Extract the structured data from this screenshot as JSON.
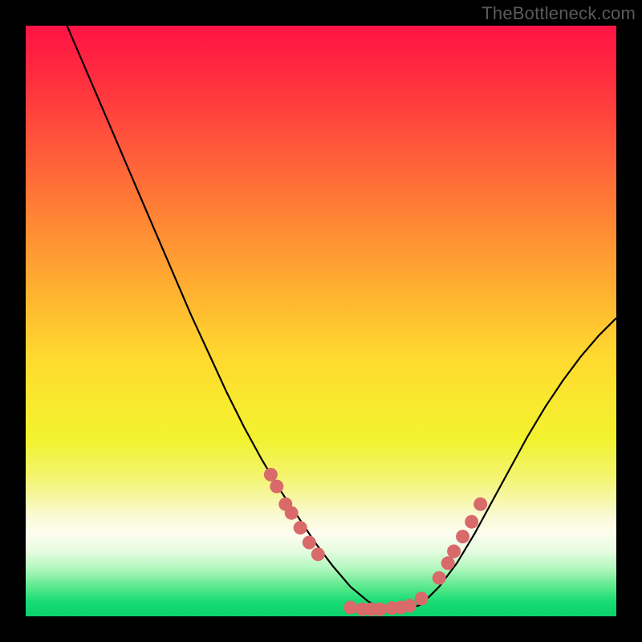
{
  "watermark": "TheBottleneck.com",
  "chart_data": {
    "type": "line",
    "title": "",
    "xlabel": "",
    "ylabel": "",
    "xlim": [
      0,
      100
    ],
    "ylim": [
      0,
      100
    ],
    "grid": false,
    "series": [
      {
        "name": "curve",
        "x": [
          7,
          10,
          13,
          16,
          19,
          22,
          25,
          28,
          31,
          34,
          37,
          40,
          43,
          46,
          49,
          52,
          55,
          58,
          61,
          64,
          67,
          70,
          73,
          76,
          79,
          82,
          85,
          88,
          91,
          94,
          97,
          100
        ],
        "values": [
          100,
          93,
          86,
          79,
          72,
          65,
          58,
          51,
          44.5,
          38,
          32,
          26.5,
          21.5,
          17,
          12.5,
          8.5,
          5,
          2.5,
          1,
          1,
          2,
          5,
          9,
          14,
          19.5,
          25,
          30.5,
          35.5,
          40,
          44,
          47.5,
          50.5
        ]
      }
    ],
    "markers": {
      "name": "data-points",
      "color": "#d96a6a",
      "x": [
        41.5,
        42.5,
        44,
        45,
        46.5,
        48,
        49.5,
        55,
        57,
        58.5,
        60,
        62,
        63.5,
        65,
        67,
        70,
        71.5,
        72.5,
        74,
        75.5,
        77
      ],
      "values": [
        24,
        22,
        19,
        17.5,
        15,
        12.5,
        10.5,
        1.5,
        1.2,
        1.2,
        1.2,
        1.4,
        1.5,
        1.8,
        3,
        6.5,
        9,
        11,
        13.5,
        16,
        19
      ]
    },
    "background_gradient": {
      "direction": "vertical",
      "stops": [
        {
          "pos": 0,
          "color": "#ff1345"
        },
        {
          "pos": 0.55,
          "color": "#ffd92f"
        },
        {
          "pos": 0.86,
          "color": "#fdfdf0"
        },
        {
          "pos": 1.0,
          "color": "#0bd26c"
        }
      ]
    }
  }
}
